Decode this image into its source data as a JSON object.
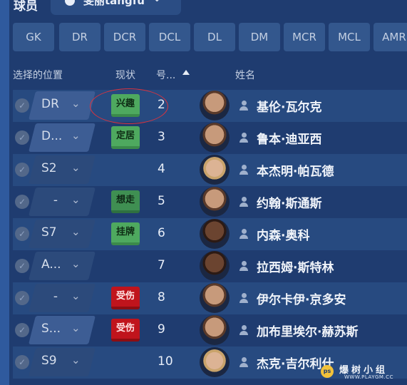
{
  "header": {
    "title": "球员",
    "player_select": "斐丽tangfu",
    "chevron": "⌄"
  },
  "position_filters": [
    "GK",
    "DR",
    "DCR",
    "DCL",
    "DL",
    "DM",
    "MCR",
    "MCL",
    "AMR"
  ],
  "columns": {
    "position": "选择的位置",
    "status": "现状",
    "number": "号...",
    "name": "姓名"
  },
  "rows": [
    {
      "position": "DR",
      "status": "兴趣",
      "status_color": "green",
      "number": "2",
      "name": "基伦·瓦尔克"
    },
    {
      "position": "D...",
      "status": "定居",
      "status_color": "green",
      "number": "3",
      "name": "鲁本·迪亚西"
    },
    {
      "position": "S2",
      "status": "",
      "status_color": "",
      "number": "4",
      "name": "本杰明·帕瓦德"
    },
    {
      "position": "-",
      "status": "想走",
      "status_color": "dark-green",
      "number": "5",
      "name": "约翰·斯通斯"
    },
    {
      "position": "S7",
      "status": "挂牌",
      "status_color": "green",
      "number": "6",
      "name": "内森·奥科"
    },
    {
      "position": "A...",
      "status": "",
      "status_color": "",
      "number": "7",
      "name": "拉西姆·斯特林"
    },
    {
      "position": "-",
      "status": "受伤",
      "status_color": "red",
      "number": "8",
      "name": "伊尔卡伊·京多安"
    },
    {
      "position": "S...",
      "status": "受伤",
      "status_color": "red",
      "number": "9",
      "name": "加布里埃尔·赫苏斯"
    },
    {
      "position": "S9",
      "status": "",
      "status_color": "",
      "number": "10",
      "name": "杰克·吉尔利什"
    }
  ],
  "watermark": {
    "text": "爆树小组",
    "url": "WWW.PLAYGM.CC",
    "logo": "ps"
  },
  "colors": {
    "background": "#1f3c70",
    "row_alt": "#274a80",
    "status_green": "#4ea95f",
    "status_red": "#c0141c",
    "highlight": "#d8333f"
  }
}
